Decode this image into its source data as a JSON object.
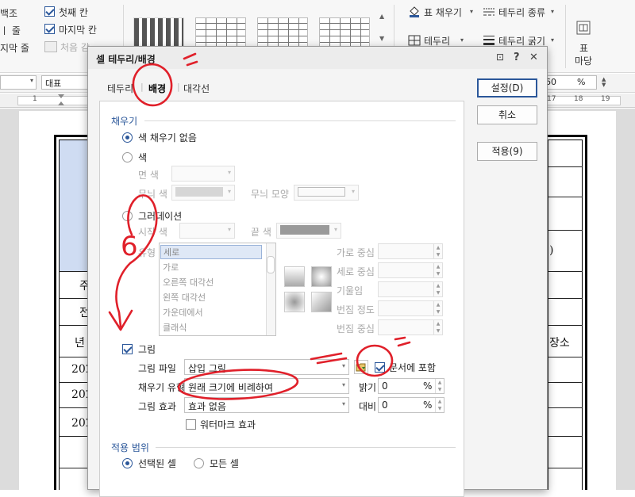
{
  "ribbon": {
    "left_items": [
      {
        "label": "백조"
      },
      {
        "label": "ㅣ 줄"
      },
      {
        "label": "지막 줄"
      }
    ],
    "checks": [
      {
        "label": "첫째 칸",
        "checked": true
      },
      {
        "label": "마지막 칸",
        "checked": true
      },
      {
        "label": "처음 감",
        "checked": false
      }
    ],
    "right_items": {
      "fill": "표 채우기",
      "border": "테두리",
      "border_type": "테두리 종류",
      "border_width": "테두리 굵기",
      "table_label": "표",
      "margin_label": "마당"
    }
  },
  "toolbar2": {
    "style_value": "대표",
    "zoom_value": "60",
    "zoom_unit": "%"
  },
  "ruler": {
    "left_numbers": [
      "1"
    ],
    "right_numbers": [
      "17",
      "18",
      "19"
    ]
  },
  "document": {
    "cell_texts": [
      "주",
      "전",
      "년",
      "202",
      "202",
      "202",
      "장소",
      ")"
    ]
  },
  "dialog": {
    "title": "셀 테두리/배경",
    "title_controls": {
      "help": "?",
      "close": "✕",
      "info": "⊡"
    },
    "tabs": [
      {
        "label": "테두리",
        "active": false
      },
      {
        "label": "배경",
        "active": true
      },
      {
        "label": "대각선",
        "active": false
      }
    ],
    "buttons": {
      "ok": "설정(D)",
      "cancel": "취소",
      "apply": "적용(9)"
    },
    "fill_section": {
      "title": "채우기",
      "no_fill": "색 채우기 없음",
      "color": "색",
      "face_color": "면 색",
      "pattern_color": "무늬 색",
      "pattern_shape": "무늬 모양",
      "gradation": "그러데이션",
      "start_color": "시작 색",
      "end_color": "끝 색",
      "type_label": "유형",
      "gradient_types": [
        "세로",
        "가로",
        "오른쪽 대각선",
        "왼쪽 대각선",
        "가운데에서",
        "클래식"
      ],
      "h_center": "가로 중심",
      "v_center": "세로 중심",
      "tilt": "기울임",
      "blur_degree": "번짐 정도",
      "blur_center": "번짐 중심"
    },
    "picture_section": {
      "picture_label": "그림",
      "picture_checked": true,
      "picture_file_label": "그림 파일",
      "picture_file_value": "삽입 그림",
      "embed_label": "문서에 포함",
      "embed_checked": true,
      "fill_type_label": "채우기 유형",
      "fill_type_value": "원래 크기에 비례하여",
      "brightness_label": "밝기",
      "brightness_value": "0",
      "contrast_label": "대비",
      "contrast_value": "0",
      "percent": "%",
      "effect_label": "그림 효과",
      "effect_value": "효과 없음",
      "watermark_label": "워터마크 효과",
      "watermark_checked": false
    },
    "scope_section": {
      "title": "적용 범위",
      "selected_cells": "선택된 셀",
      "all_cells": "모든 셀",
      "selected": "selected_cells"
    }
  },
  "annotation": {
    "step_number": "6",
    "color": "#e0202a"
  },
  "colors": {
    "accent": "#2b579a",
    "table_highlight": "#cfdcf2"
  }
}
